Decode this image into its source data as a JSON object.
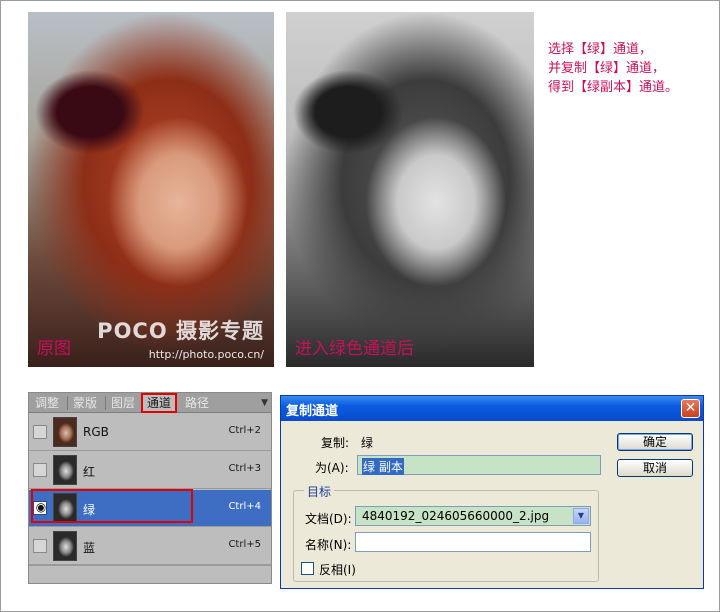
{
  "photos": {
    "original_caption": "原图",
    "green_caption": "进入绿色通道后",
    "watermark_logo": "POCO 摄影专题",
    "watermark_url": "http://photo.poco.cn/"
  },
  "note": {
    "text": "选择【绿】通道，\n并复制【绿】通道，\n得到【绿副本】通道。"
  },
  "channels_panel": {
    "tabs": [
      "调整",
      "蒙版",
      "图层",
      "通道",
      "路径"
    ],
    "active_tab": "通道",
    "rows": [
      {
        "name": "RGB",
        "shortcut": "Ctrl+2",
        "visible": false
      },
      {
        "name": "红",
        "shortcut": "Ctrl+3",
        "visible": false
      },
      {
        "name": "绿",
        "shortcut": "Ctrl+4",
        "visible": true
      },
      {
        "name": "蓝",
        "shortcut": "Ctrl+5",
        "visible": false
      }
    ],
    "eye_icon": "eye-icon",
    "colors": {
      "selected_row": "#3d6ec4",
      "highlight": "#e00000"
    }
  },
  "dialog": {
    "title": "复制通道",
    "close_glyph": "✕",
    "copy_label": "复制:",
    "copy_value": "绿",
    "as_label": "为(A):",
    "as_value": "绿 副本",
    "group_label": "目标",
    "document_label": "文档(D):",
    "document_value": "4840192_024605660000_2.jpg",
    "name_label": "名称(N):",
    "name_value": "",
    "invert_label": "反相(I)",
    "invert_checked": false,
    "ok_label": "确定",
    "cancel_label": "取消"
  }
}
